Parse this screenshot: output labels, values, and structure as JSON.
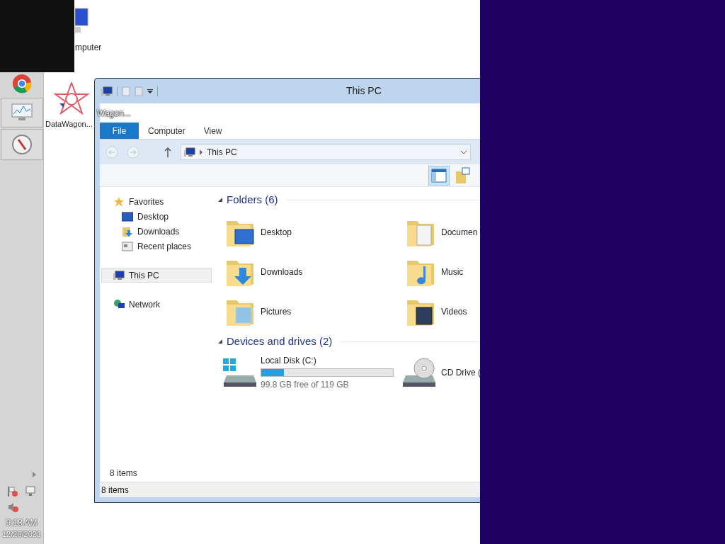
{
  "desktop_icons": [
    {
      "label": "mputer"
    },
    {
      "label": "DataWagon..."
    }
  ],
  "taskbar": {
    "time": "9:13 AM",
    "date": "12/20/2021"
  },
  "window": {
    "title": "This PC",
    "overlay_label": "Wagon...",
    "ribbon_tabs": [
      {
        "label": "File",
        "selected": true
      },
      {
        "label": "Computer",
        "selected": false
      },
      {
        "label": "View",
        "selected": false
      }
    ],
    "address": {
      "crumb": "This PC"
    },
    "nav": [
      {
        "label": "Favorites",
        "selected": false,
        "children": [
          {
            "label": "Desktop",
            "selected": false
          },
          {
            "label": "Downloads",
            "selected": false
          },
          {
            "label": "Recent places",
            "selected": false
          }
        ]
      },
      {
        "label": "This PC",
        "selected": true
      },
      {
        "label": "Network",
        "selected": false
      }
    ],
    "folders": {
      "heading": "Folders (6)",
      "items": [
        {
          "label": "Desktop"
        },
        {
          "label": "Documen"
        },
        {
          "label": "Downloads"
        },
        {
          "label": "Music"
        },
        {
          "label": "Pictures"
        },
        {
          "label": "Videos"
        }
      ]
    },
    "drives": {
      "heading": "Devices and drives (2)",
      "items": [
        {
          "kind": "disk",
          "label": "Local Disk (C:)",
          "level": 0.17,
          "free": "99.8 GB free of 119 GB"
        },
        {
          "kind": "cd",
          "label": "CD Drive ("
        }
      ]
    },
    "content_footer": "8 items",
    "status_bar": "8 items"
  }
}
